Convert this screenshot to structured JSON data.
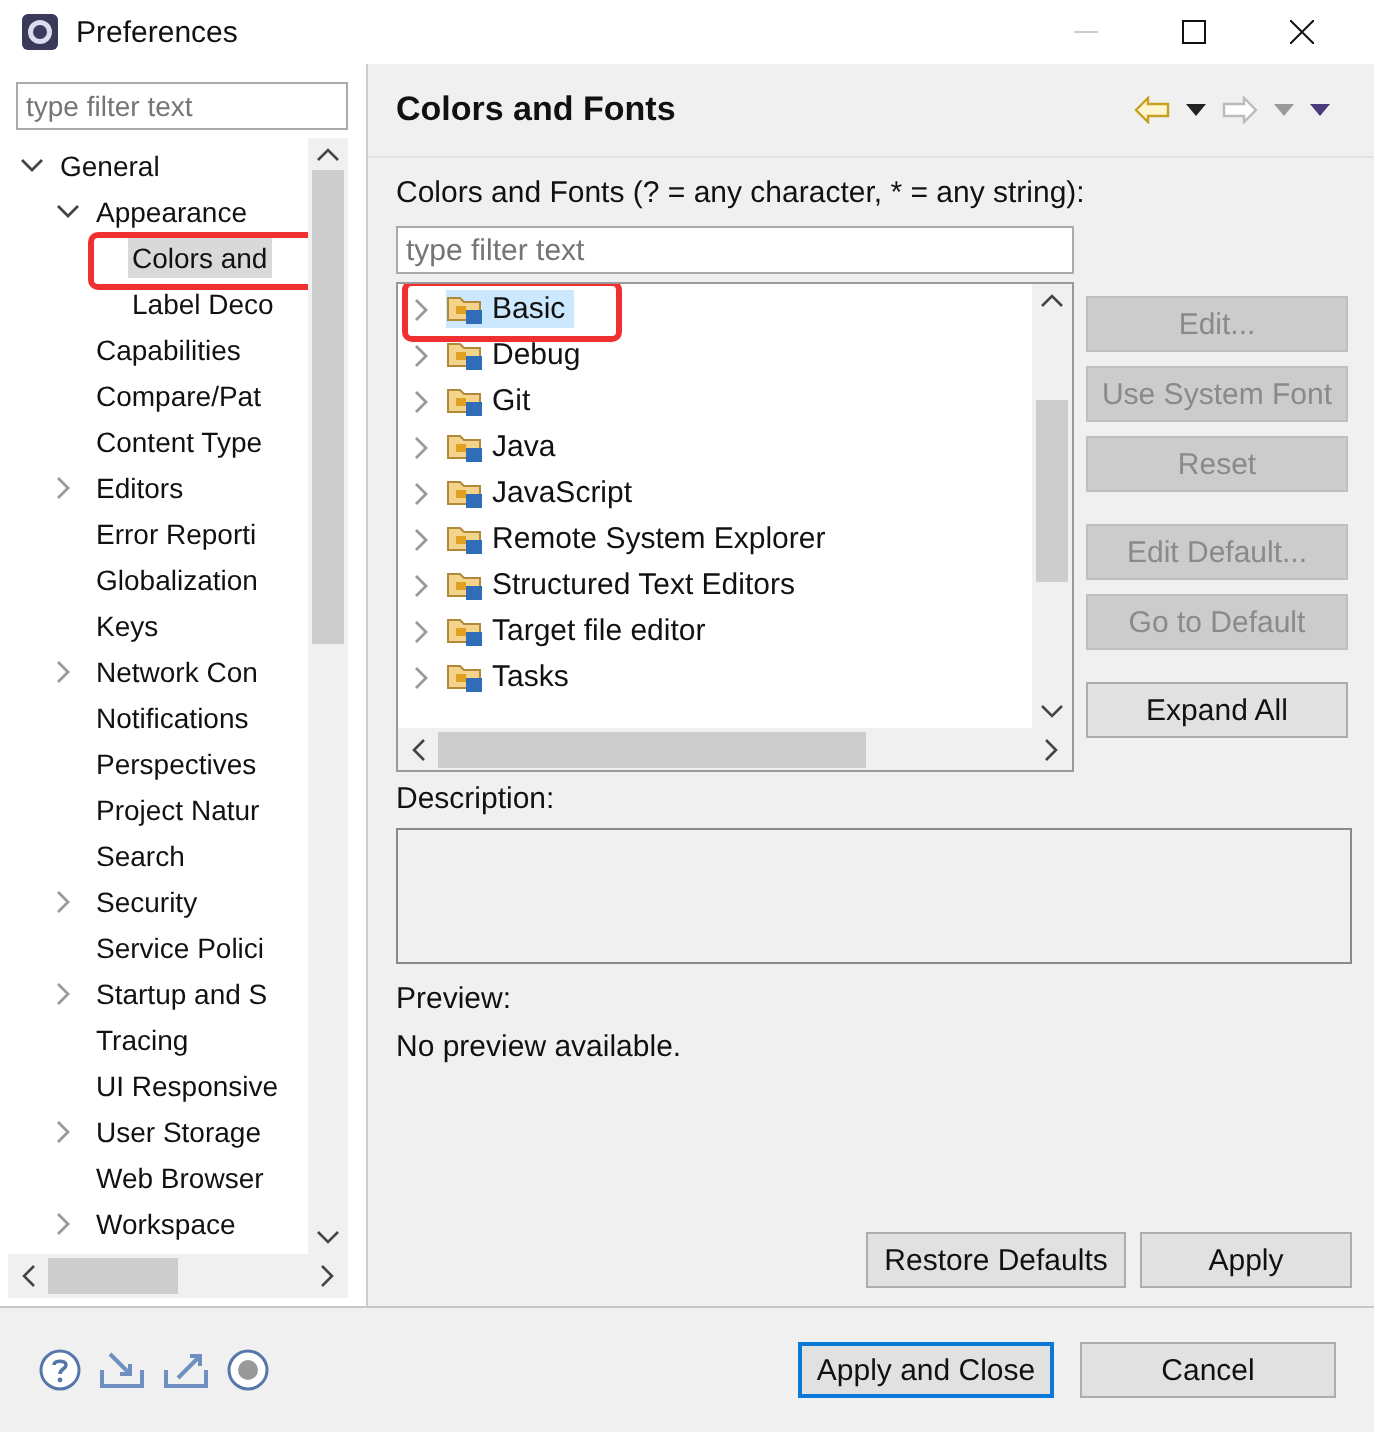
{
  "window": {
    "title": "Preferences"
  },
  "filter": {
    "placeholder": "type filter text"
  },
  "tree": {
    "items": [
      {
        "label": "General",
        "expanded": true,
        "selected": false,
        "marked": false,
        "children": [
          {
            "label": "Appearance",
            "expanded": true,
            "selected": false,
            "marked": false,
            "children": [
              {
                "label": "Colors and",
                "selected": true,
                "marked": true
              },
              {
                "label": "Label Deco",
                "selected": false,
                "marked": false
              }
            ]
          },
          {
            "label": "Capabilities",
            "selected": false,
            "marked": false
          },
          {
            "label": "Compare/Pat",
            "selected": false,
            "marked": false
          },
          {
            "label": "Content Type",
            "selected": false,
            "marked": false
          },
          {
            "label": "Editors",
            "expanded": false,
            "selected": false,
            "marked": false
          },
          {
            "label": "Error Reporti",
            "selected": false,
            "marked": false
          },
          {
            "label": "Globalization",
            "selected": false,
            "marked": false
          },
          {
            "label": "Keys",
            "selected": false,
            "marked": false
          },
          {
            "label": "Network Con",
            "expanded": false,
            "selected": false,
            "marked": false
          },
          {
            "label": "Notifications",
            "selected": false,
            "marked": false
          },
          {
            "label": "Perspectives",
            "selected": false,
            "marked": false
          },
          {
            "label": "Project Natur",
            "selected": false,
            "marked": false
          },
          {
            "label": "Search",
            "selected": false,
            "marked": false
          },
          {
            "label": "Security",
            "expanded": false,
            "selected": false,
            "marked": false
          },
          {
            "label": "Service Polici",
            "selected": false,
            "marked": false
          },
          {
            "label": "Startup and S",
            "expanded": false,
            "selected": false,
            "marked": false
          },
          {
            "label": "Tracing",
            "selected": false,
            "marked": false
          },
          {
            "label": "UI Responsive",
            "selected": false,
            "marked": false
          },
          {
            "label": "User Storage",
            "expanded": false,
            "selected": false,
            "marked": false
          },
          {
            "label": "Web Browser",
            "selected": false,
            "marked": false
          },
          {
            "label": "Workspace",
            "expanded": false,
            "selected": false,
            "marked": false
          }
        ]
      }
    ]
  },
  "page": {
    "title": "Colors and Fonts",
    "filter_label": "Colors and Fonts (? = any character, * = any string):",
    "filter": {
      "placeholder": "type filter text"
    },
    "categories": [
      {
        "label": "Basic",
        "selected": true,
        "marked": true
      },
      {
        "label": "Debug",
        "selected": false,
        "marked": false
      },
      {
        "label": "Git",
        "selected": false,
        "marked": false
      },
      {
        "label": "Java",
        "selected": false,
        "marked": false
      },
      {
        "label": "JavaScript",
        "selected": false,
        "marked": false
      },
      {
        "label": "Remote System Explorer",
        "selected": false,
        "marked": false
      },
      {
        "label": "Structured Text Editors",
        "selected": false,
        "marked": false
      },
      {
        "label": "Target file editor",
        "selected": false,
        "marked": false
      },
      {
        "label": "Tasks",
        "selected": false,
        "marked": false
      }
    ],
    "side_button_groups": [
      [
        {
          "label": "Edit...",
          "disabled": true
        },
        {
          "label": "Use System Font",
          "disabled": true
        },
        {
          "label": "Reset",
          "disabled": true
        }
      ],
      [
        {
          "label": "Edit Default...",
          "disabled": true
        },
        {
          "label": "Go to Default",
          "disabled": true
        }
      ],
      [
        {
          "label": "Expand All",
          "disabled": false
        }
      ]
    ],
    "description_label": "Description:",
    "preview_label": "Preview:",
    "preview_text": "No preview available.",
    "buttons": [
      {
        "label": "Restore Defaults"
      },
      {
        "label": "Apply"
      }
    ]
  },
  "footer": {
    "buttons": [
      {
        "label": "Apply and Close",
        "default": true
      },
      {
        "label": "Cancel",
        "default": false
      }
    ]
  }
}
